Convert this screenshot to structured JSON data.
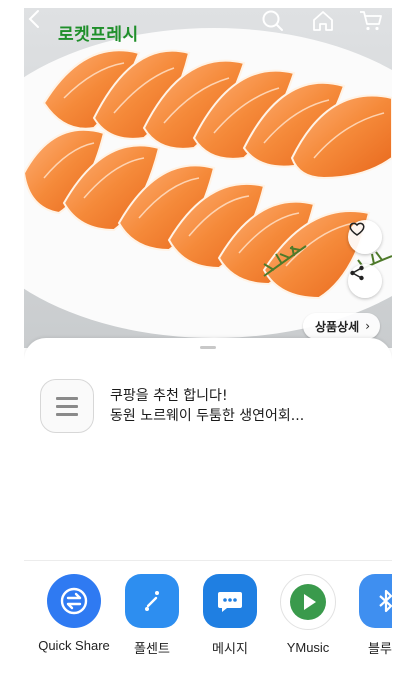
{
  "header": {
    "brand": "로켓프레시",
    "icons": [
      "back-chevron-icon",
      "search-icon",
      "home-icon",
      "cart-icon"
    ]
  },
  "product": {
    "detail_button": "상품상세",
    "actions": [
      "heart-icon",
      "share-icon"
    ]
  },
  "share_sheet": {
    "title_line1": "쿠팡을 추천 합니다!",
    "title_line2": "동원 노르웨이 두툼한 생연어회...",
    "apps": [
      {
        "label": "Quick Share",
        "icon": "quick-share-icon",
        "color": "#2f7af2"
      },
      {
        "label": "폴센트",
        "icon": "pollcent-icon",
        "color": "#2d8ef0"
      },
      {
        "label": "메시지",
        "icon": "message-icon",
        "color": "#1f7fe2"
      },
      {
        "label": "YMusic",
        "icon": "ymusic-icon",
        "color": "#3a9a4c"
      },
      {
        "label": "블루투",
        "icon": "bluetooth-icon",
        "color": "#3f8ff0"
      }
    ]
  },
  "colors": {
    "brand": "#1f8f2a",
    "background": "#ffffff"
  }
}
